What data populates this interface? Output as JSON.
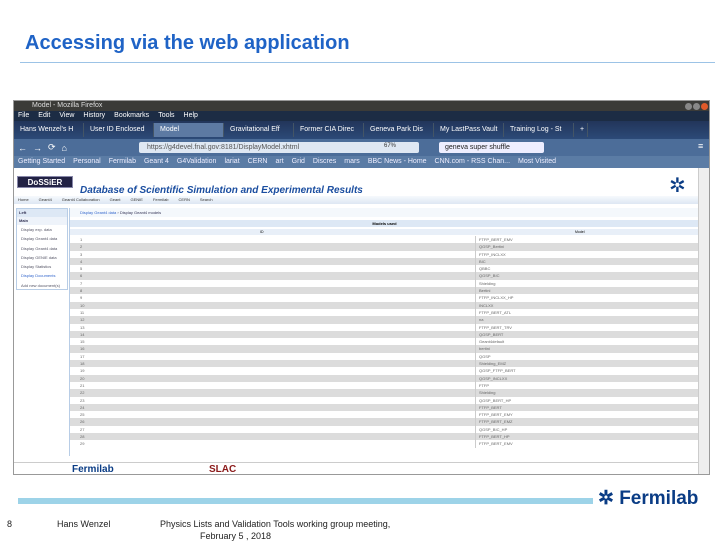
{
  "slide": {
    "title": "Accessing via the web application",
    "page_number": "8",
    "author": "Hans Wenzel",
    "meeting": "Physics Lists and Validation Tools working group meeting,",
    "date": "February 5 , 2018",
    "logo": "Fermilab"
  },
  "browser": {
    "window_title": "Model - Mozilla Firefox",
    "menu": [
      "File",
      "Edit",
      "View",
      "History",
      "Bookmarks",
      "Tools",
      "Help"
    ],
    "tabs": [
      "Hans Wenzel's H",
      "User ID Enclosed",
      "Model",
      "Gravitational Eff",
      "Former CIA Direc",
      "Geneva Park Dis",
      "My LastPass Vault",
      "Training Log - St"
    ],
    "url": "https://g4devel.fnal.gov:8181/DisplayModel.xhtml",
    "zoom": "67%",
    "search": "geneva super shuffle",
    "bookmarks": [
      "Getting Started",
      "Personal",
      "Fermilab",
      "Geant 4",
      "G4Validation",
      "lariat",
      "CERN",
      "art",
      "Grid",
      "Discres",
      "mars",
      "BBC News - Home",
      "CNN.com - RSS Chan...",
      "Most Visited"
    ]
  },
  "site": {
    "logo": "DoSSiER",
    "title": "Database of Scientific Simulation and Experimental Results",
    "fermilab_logo": "Fermilab",
    "nav": [
      "Home",
      "Geant4",
      "Geant4 Collaboration",
      "Geant",
      "GENIE",
      "Fermilab",
      "CERN",
      "Search"
    ],
    "left_title": "Left",
    "left_section": "Main",
    "left_items": [
      "Display exp. data",
      "Display Geant4 data",
      "Display Geant4 data",
      "Display GENIE data",
      "Display Statistics",
      "Display Documents",
      "Add new document(s)"
    ],
    "breadcrumb": [
      "Display Geant4 data",
      "Display Geant4 models"
    ],
    "table_title": "Models used",
    "col_id": "ID",
    "col_model": "Model",
    "rows": [
      "FTFP_BERT_EMV",
      "QGSP_Bertini",
      "FTFP_INCLXX",
      "BIC",
      "QBBC",
      "QGSP_BIC",
      "Shielding",
      "Bertini",
      "FTFP_INCLXX_HP",
      "INCLXX",
      "FTFP_BERT_ATL",
      "na",
      "FTFP_BERT_TRV",
      "QGSP_BERT",
      "Geant4default",
      "bertini",
      "QGSP",
      "Shielding_EMZ",
      "QGSP_FTFP_BERT",
      "QGSP_INCLXX",
      "FTFP",
      "Shielding",
      "QGSP_BERT_HP",
      "FTFP_BERT",
      "FTFP_BERT_EMY",
      "FTFP_BERT_EMZ",
      "QGSP_BIC_HP",
      "FTFP_BERT_HP",
      "FTFP_BERT_EMV"
    ],
    "footer_logos": [
      "Fermilab",
      "SLAC"
    ]
  }
}
